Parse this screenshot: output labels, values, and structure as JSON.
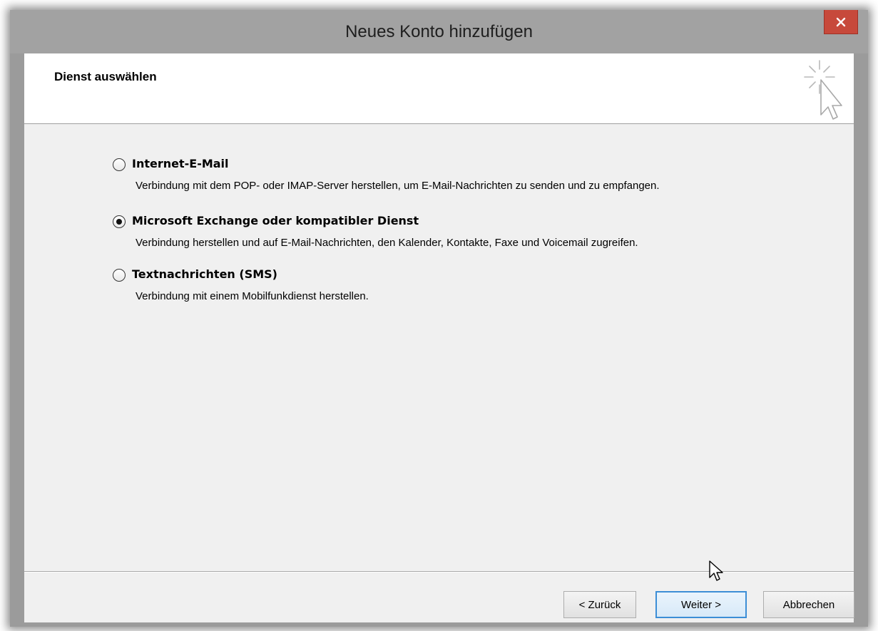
{
  "window": {
    "title": "Neues Konto hinzufügen",
    "close_icon": "close-icon"
  },
  "header": {
    "title": "Dienst auswählen",
    "icon": "wizard-cursor-icon"
  },
  "options": [
    {
      "label": "Internet-E-Mail",
      "description": "Verbindung mit dem POP- oder IMAP-Server herstellen, um E-Mail-Nachrichten zu senden und zu empfangen.",
      "selected": false
    },
    {
      "label": "Microsoft Exchange oder kompatibler Dienst",
      "description": "Verbindung herstellen und auf E-Mail-Nachrichten, den Kalender, Kontakte, Faxe und Voicemail zugreifen.",
      "selected": true
    },
    {
      "label": "Textnachrichten (SMS)",
      "description": "Verbindung mit einem Mobilfunkdienst herstellen.",
      "selected": false
    }
  ],
  "buttons": {
    "back": "< Zurück",
    "next": "Weiter >",
    "cancel": "Abbrechen"
  },
  "colors": {
    "close_button": "#c7493b",
    "default_button_border": "#3c8ed6"
  }
}
